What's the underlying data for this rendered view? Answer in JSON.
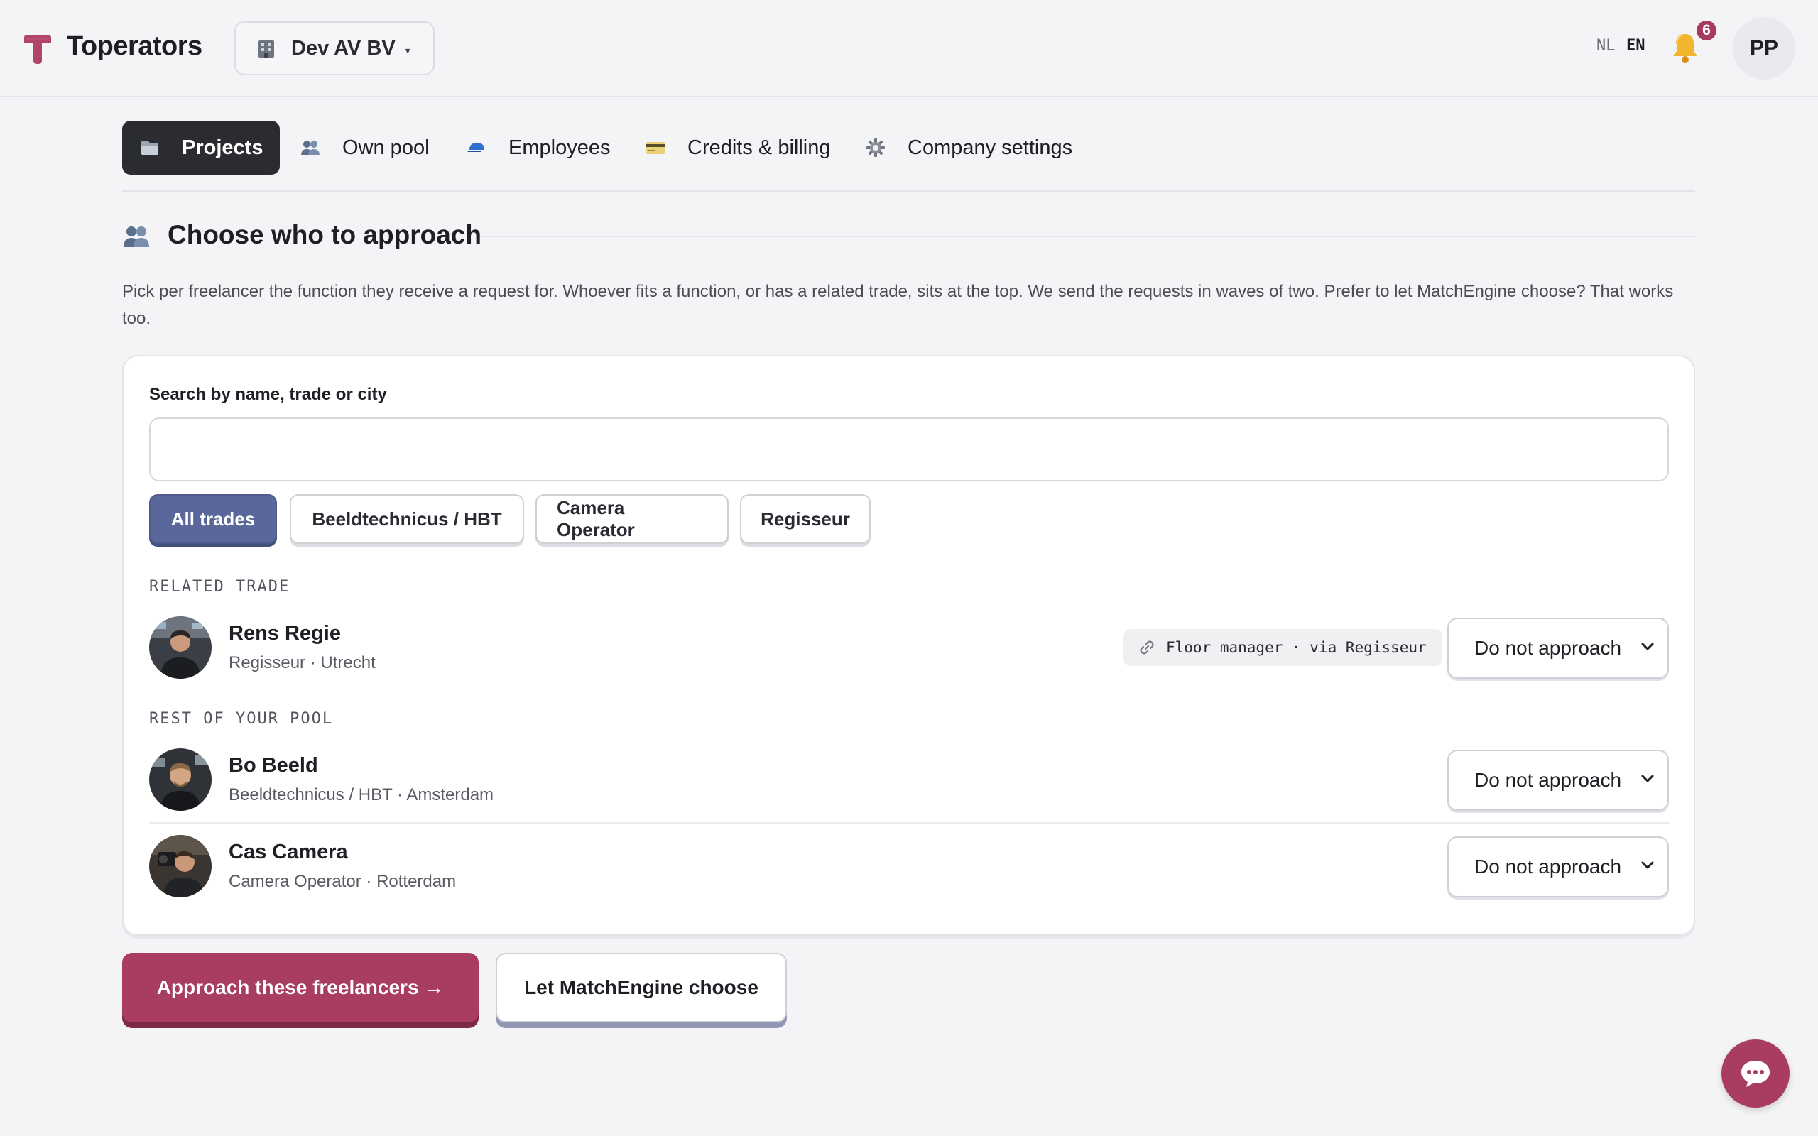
{
  "header": {
    "brand": "Toperators",
    "company": "Dev AV BV",
    "company_caret": "▾",
    "lang_nl": "NL",
    "lang_en": "EN",
    "notifications_count": "6",
    "user_initials": "PP"
  },
  "nav": {
    "tabs": [
      {
        "label": "Projects",
        "icon": "folder-icon",
        "active": true
      },
      {
        "label": "Own pool",
        "icon": "people-icon"
      },
      {
        "label": "Employees",
        "icon": "cap-icon"
      },
      {
        "label": "Credits & billing",
        "icon": "credit-card-icon"
      },
      {
        "label": "Company settings",
        "icon": "gear-icon"
      }
    ]
  },
  "section": {
    "title": "Choose who to approach",
    "description": "Pick per freelancer the function they receive a request for. Whoever fits a function, or has a related trade, sits at the top. We send the requests in waves of two. Prefer to let MatchEngine choose? That works too."
  },
  "search": {
    "label": "Search by name, trade or city",
    "value": "",
    "placeholder": ""
  },
  "filters": [
    {
      "label": "All trades",
      "active": true
    },
    {
      "label": "Beeldtechnicus / HBT"
    },
    {
      "label": "Camera Operator"
    },
    {
      "label": "Regisseur"
    }
  ],
  "groups": {
    "related_label": "RELATED TRADE",
    "rest_label": "REST OF YOUR POOL"
  },
  "people": [
    {
      "name": "Rens Regie",
      "meta": "Regisseur · Utrecht",
      "tag": "Floor manager · via Regisseur",
      "status": "Do not approach"
    },
    {
      "name": "Bo Beeld",
      "meta": "Beeldtechnicus / HBT · Amsterdam",
      "status": "Do not approach"
    },
    {
      "name": "Cas Camera",
      "meta": "Camera Operator · Rotterdam",
      "status": "Do not approach"
    }
  ],
  "actions": {
    "primary": "Approach these freelancers →",
    "secondary": "Let MatchEngine choose"
  },
  "colors": {
    "accent": "#a83d61",
    "filter_active": "#59679a",
    "nav_active": "#2b2c30"
  }
}
